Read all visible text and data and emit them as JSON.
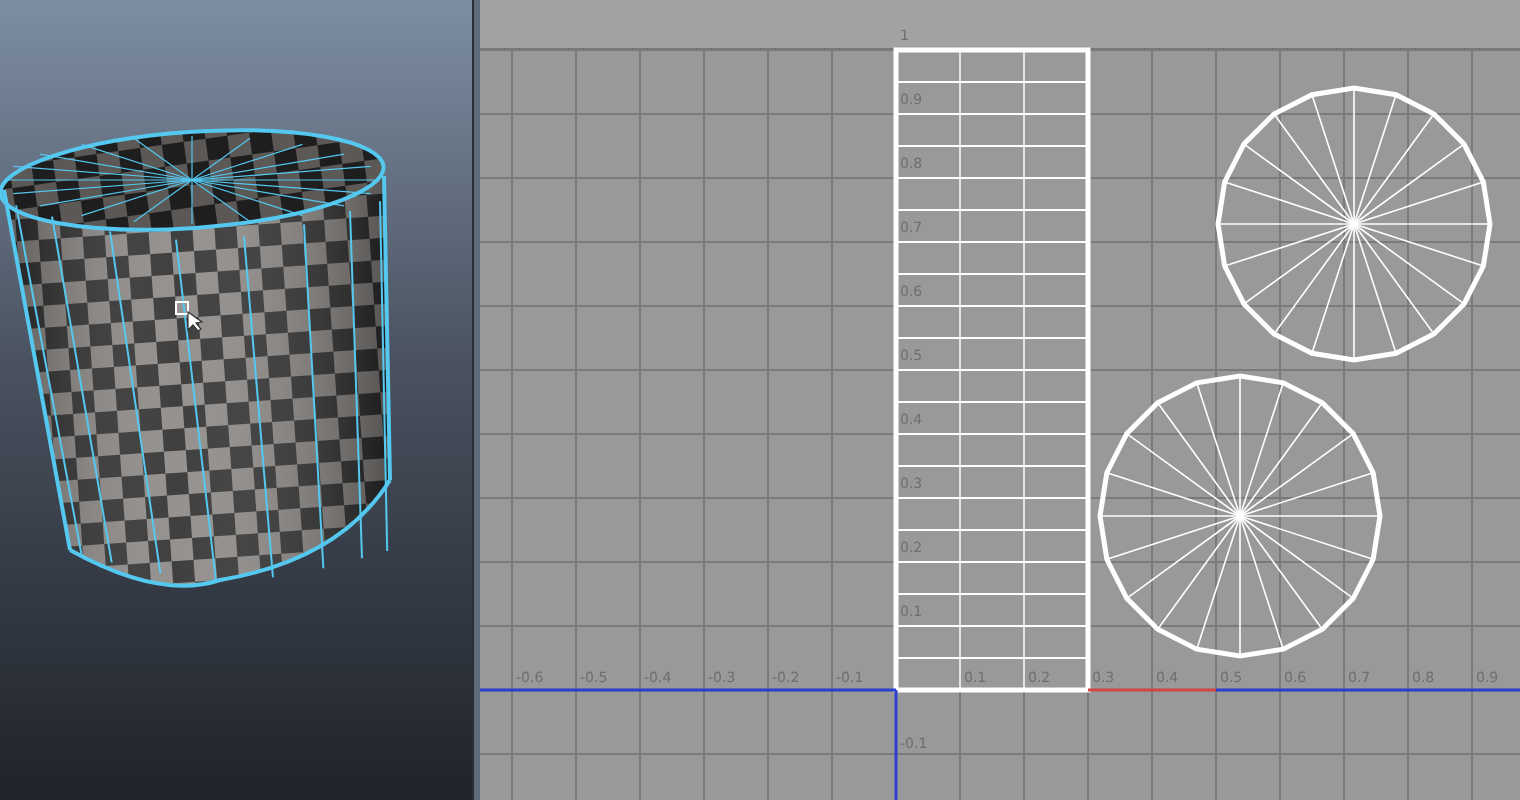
{
  "viewport": {
    "cursor_visible": true
  },
  "uv_editor": {
    "v_labels": [
      "1",
      "0.9",
      "0.8",
      "0.7",
      "0.6",
      "0.5",
      "0.4",
      "0.3",
      "0.2",
      "0.1"
    ],
    "u_labels": [
      "-0.6",
      "-0.5",
      "-0.4",
      "-0.3",
      "-0.2",
      "-0.1",
      "0.1",
      "0.2",
      "0.3",
      "0.4",
      "0.5",
      "0.6",
      "0.7",
      "0.8",
      "0.9"
    ],
    "below_labels": [
      "-0.1"
    ]
  }
}
